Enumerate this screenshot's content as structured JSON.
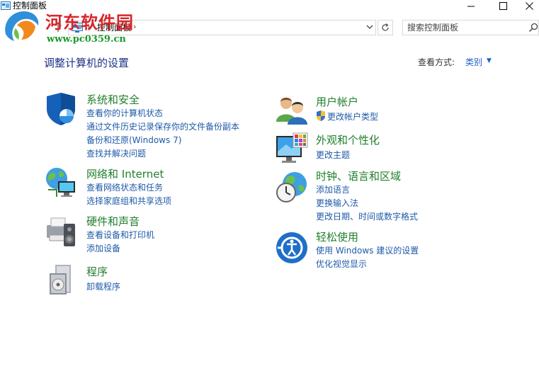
{
  "window": {
    "title": "控制面板"
  },
  "watermark": {
    "site_name": "河东软件园",
    "url": "www.pc0359.cn"
  },
  "address": {
    "path": "控制面板"
  },
  "search": {
    "placeholder": "搜索控制面板"
  },
  "main": {
    "heading": "调整计算机的设置",
    "view_label": "查看方式:",
    "view_value": "类别"
  },
  "categories": {
    "system": {
      "title": "系统和安全",
      "links": [
        "查看你的计算机状态",
        "通过文件历史记录保存你的文件备份副本",
        "备份和还原(Windows 7)",
        "查找并解决问题"
      ]
    },
    "network": {
      "title": "网络和 Internet",
      "links": [
        "查看网络状态和任务",
        "选择家庭组和共享选项"
      ]
    },
    "hardware": {
      "title": "硬件和声音",
      "links": [
        "查看设备和打印机",
        "添加设备"
      ]
    },
    "programs": {
      "title": "程序",
      "links": [
        "卸载程序"
      ]
    },
    "accounts": {
      "title": "用户帐户",
      "links": [
        "更改帐户类型"
      ]
    },
    "appearance": {
      "title": "外观和个性化",
      "links": [
        "更改主题"
      ]
    },
    "clock": {
      "title": "时钟、语言和区域",
      "links": [
        "添加语言",
        "更换输入法",
        "更改日期、时间或数字格式"
      ]
    },
    "ease": {
      "title": "轻松使用",
      "links": [
        "使用 Windows 建议的设置",
        "优化视觉显示"
      ]
    }
  },
  "colors": {
    "category_title": "#207f2c",
    "link": "#1e5aa8",
    "heading": "#1e3287",
    "watermark_red": "#d8262a",
    "watermark_green": "#1a9a2a"
  }
}
